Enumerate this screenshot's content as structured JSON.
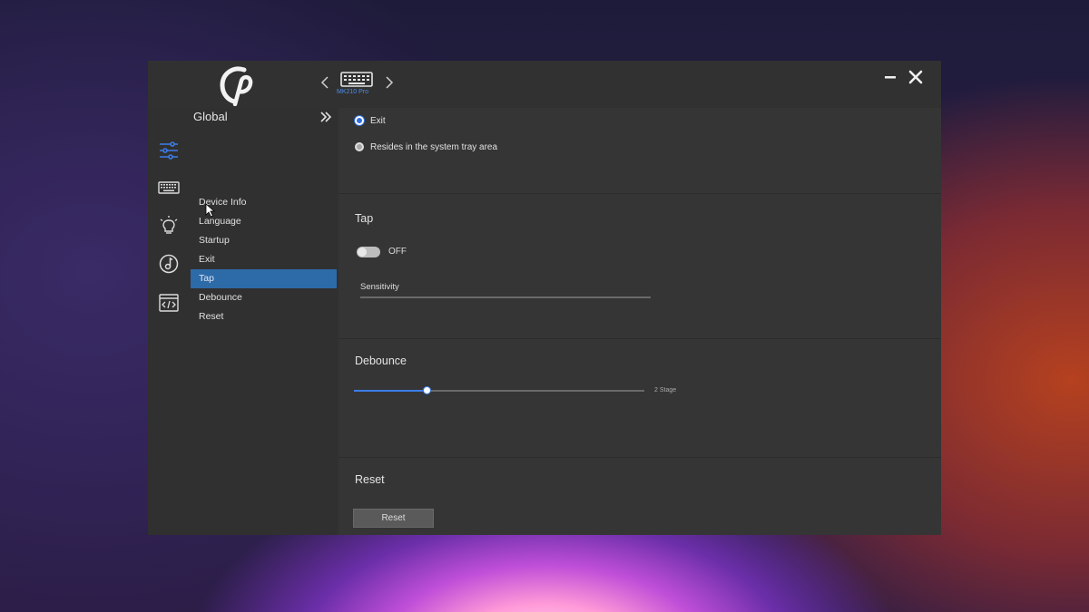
{
  "colors": {
    "window_bg": "#333333",
    "accent": "#3b7de8",
    "selected_item": "#2d6aa8"
  },
  "header": {
    "device_label": "MK210 Pro",
    "icons": [
      "app-logo",
      "chevron-left-icon",
      "keyboard-icon",
      "chevron-right-icon",
      "minimize-icon",
      "close-icon"
    ]
  },
  "iconbar": {
    "icons": [
      "sliders-icon",
      "keyboard-icon",
      "lightbulb-icon",
      "music-note-icon",
      "code-icon"
    ],
    "active": "sliders-icon"
  },
  "menu": {
    "title": "Global",
    "items": [
      {
        "label": "Device Info"
      },
      {
        "label": "Language"
      },
      {
        "label": "Startup"
      },
      {
        "label": "Exit"
      },
      {
        "label": "Tap"
      },
      {
        "label": "Debounce"
      },
      {
        "label": "Reset"
      }
    ],
    "active": "Tap"
  },
  "exit_section": {
    "options": [
      {
        "label": "Exit",
        "selected": true
      },
      {
        "label": "Resides in the system tray area",
        "selected": false
      }
    ]
  },
  "tap_section": {
    "title": "Tap",
    "toggle_label": "OFF",
    "toggle_on": false,
    "sensitivity_label": "Sensitivity"
  },
  "debounce_section": {
    "title": "Debounce",
    "stage_label": "2 Stage",
    "slider_value_fraction": 0.25
  },
  "reset_section": {
    "title": "Reset",
    "button_label": "Reset"
  }
}
